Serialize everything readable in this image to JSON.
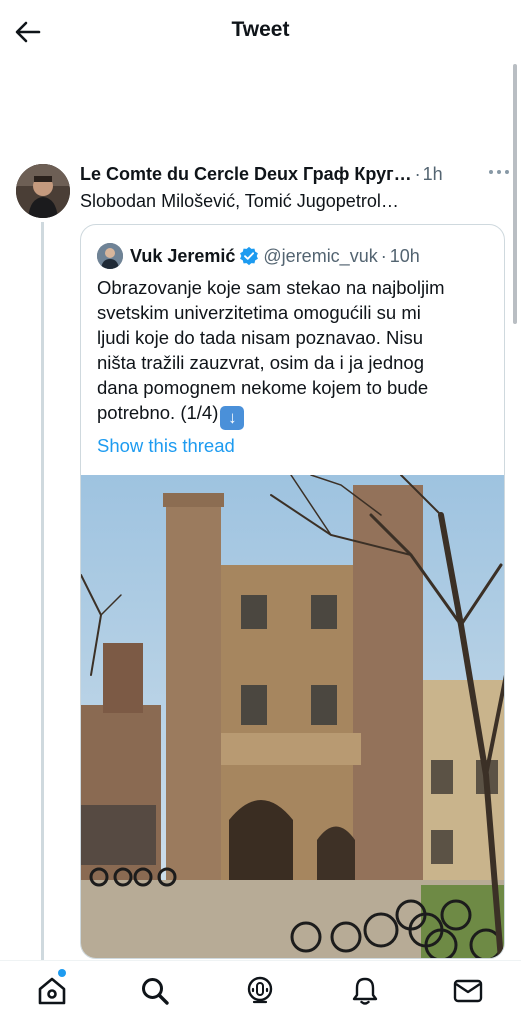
{
  "header": {
    "title": "Tweet"
  },
  "post": {
    "author_name": "Le Comte du Cercle Deux Граф Круг…",
    "time_separator": "·",
    "time": "1h",
    "text": "Slobodan Milošević, Tomić Jugopetrol…"
  },
  "quote": {
    "author_name": "Vuk Jeremić",
    "handle": "@jeremic_vuk",
    "time_separator": "·",
    "time": "10h",
    "lines": [
      "Obrazovanje koje sam stekao na najboljim",
      "svetskim univerzitetima omogućili su mi",
      "ljudi koje do tada nisam poznavao. Nisu",
      "ništa tražili zauzvrat, osim da i ja jednog",
      "dana pomognem nekome kojem to bude"
    ],
    "last_line": "potrebno. (1/4)",
    "show_thread": "Show this thread"
  },
  "icons": {
    "back": "back-arrow-icon",
    "more": "more-dots-icon",
    "verified": "verified-badge-icon",
    "arrow_down_emoji": "down-arrow-emoji-icon",
    "home": "home-icon",
    "search": "search-icon",
    "spaces": "spaces-icon",
    "notifications": "bell-icon",
    "messages": "mail-icon"
  },
  "colors": {
    "accent": "#1d9bf0",
    "text": "#0f1419",
    "secondary": "#536471",
    "border": "#cfd9de"
  }
}
